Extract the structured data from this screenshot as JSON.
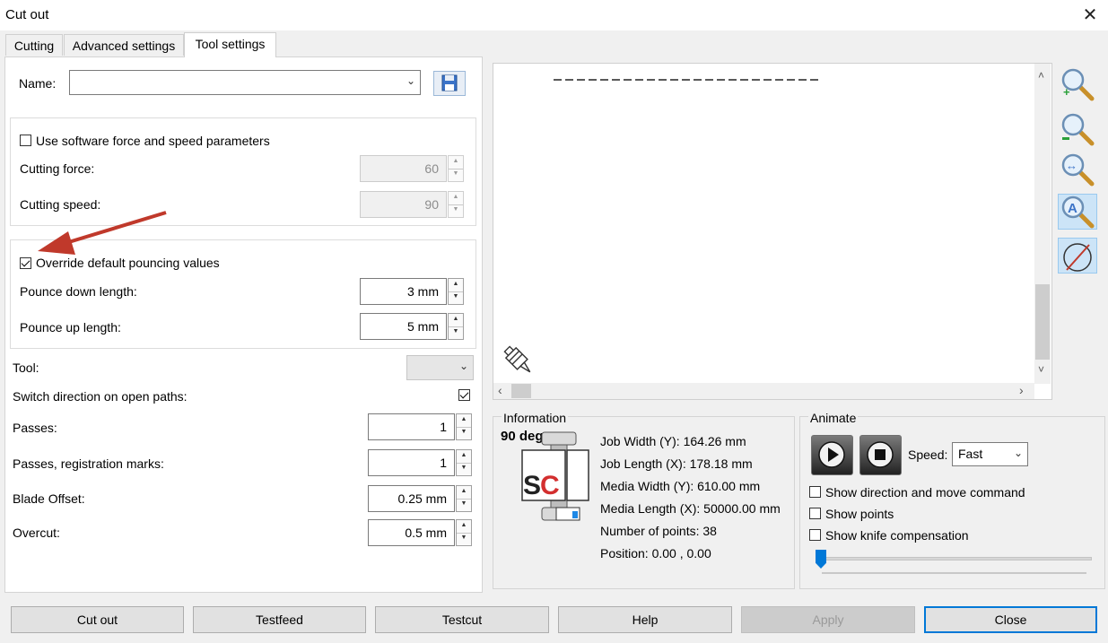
{
  "window": {
    "title": "Cut out",
    "close_glyph": "✕"
  },
  "tabs": [
    {
      "label": "Cutting",
      "active": false
    },
    {
      "label": "Advanced settings",
      "active": false
    },
    {
      "label": "Tool settings",
      "active": true
    }
  ],
  "tool_settings": {
    "name_label": "Name:",
    "name_value": "",
    "save_icon": "floppy-disk-icon",
    "software_params": {
      "checkbox_label": "Use software force and speed parameters",
      "checked": false,
      "force_label": "Cutting force:",
      "force_value": "60",
      "speed_label": "Cutting speed:",
      "speed_value": "90"
    },
    "pouncing": {
      "checkbox_label": "Override default pouncing values",
      "checked": true,
      "down_label": "Pounce down length:",
      "down_value": "3 mm",
      "up_label": "Pounce up length:",
      "up_value": "5 mm"
    },
    "tool_label": "Tool:",
    "tool_value": "",
    "switch_label": "Switch direction on open paths:",
    "switch_checked": true,
    "passes_label": "Passes:",
    "passes_value": "1",
    "reg_passes_label": "Passes, registration marks:",
    "reg_passes_value": "1",
    "blade_label": "Blade Offset:",
    "blade_value": "0.25 mm",
    "overcut_label": "Overcut:",
    "overcut_value": "0.5 mm"
  },
  "annotation": {
    "color": "#c0392b",
    "icon": "red-arrow-annotation"
  },
  "zoom_tools": [
    "zoom-in-icon",
    "zoom-out-icon",
    "zoom-fit-width-icon",
    "auto-zoom-icon",
    "no-preview-icon"
  ],
  "information": {
    "title": "Information",
    "rotation": "90 deg",
    "logo_text": "SC",
    "job_width": "Job Width (Y): 164.26 mm",
    "job_length": "Job Length (X): 178.18 mm",
    "media_width": "Media Width (Y): 610.00 mm",
    "media_length": "Media Length (X): 50000.00 mm",
    "num_points": "Number of points: 38",
    "position": "Position: 0.00 , 0.00"
  },
  "animate": {
    "title": "Animate",
    "speed_label": "Speed:",
    "speed_value": "Fast",
    "opt_direction": "Show direction and move command",
    "opt_points": "Show points",
    "opt_knife": "Show knife compensation",
    "slider_value": 0
  },
  "buttons": {
    "cut_out": "Cut out",
    "testfeed": "Testfeed",
    "testcut": "Testcut",
    "help": "Help",
    "apply": "Apply",
    "close": "Close"
  }
}
